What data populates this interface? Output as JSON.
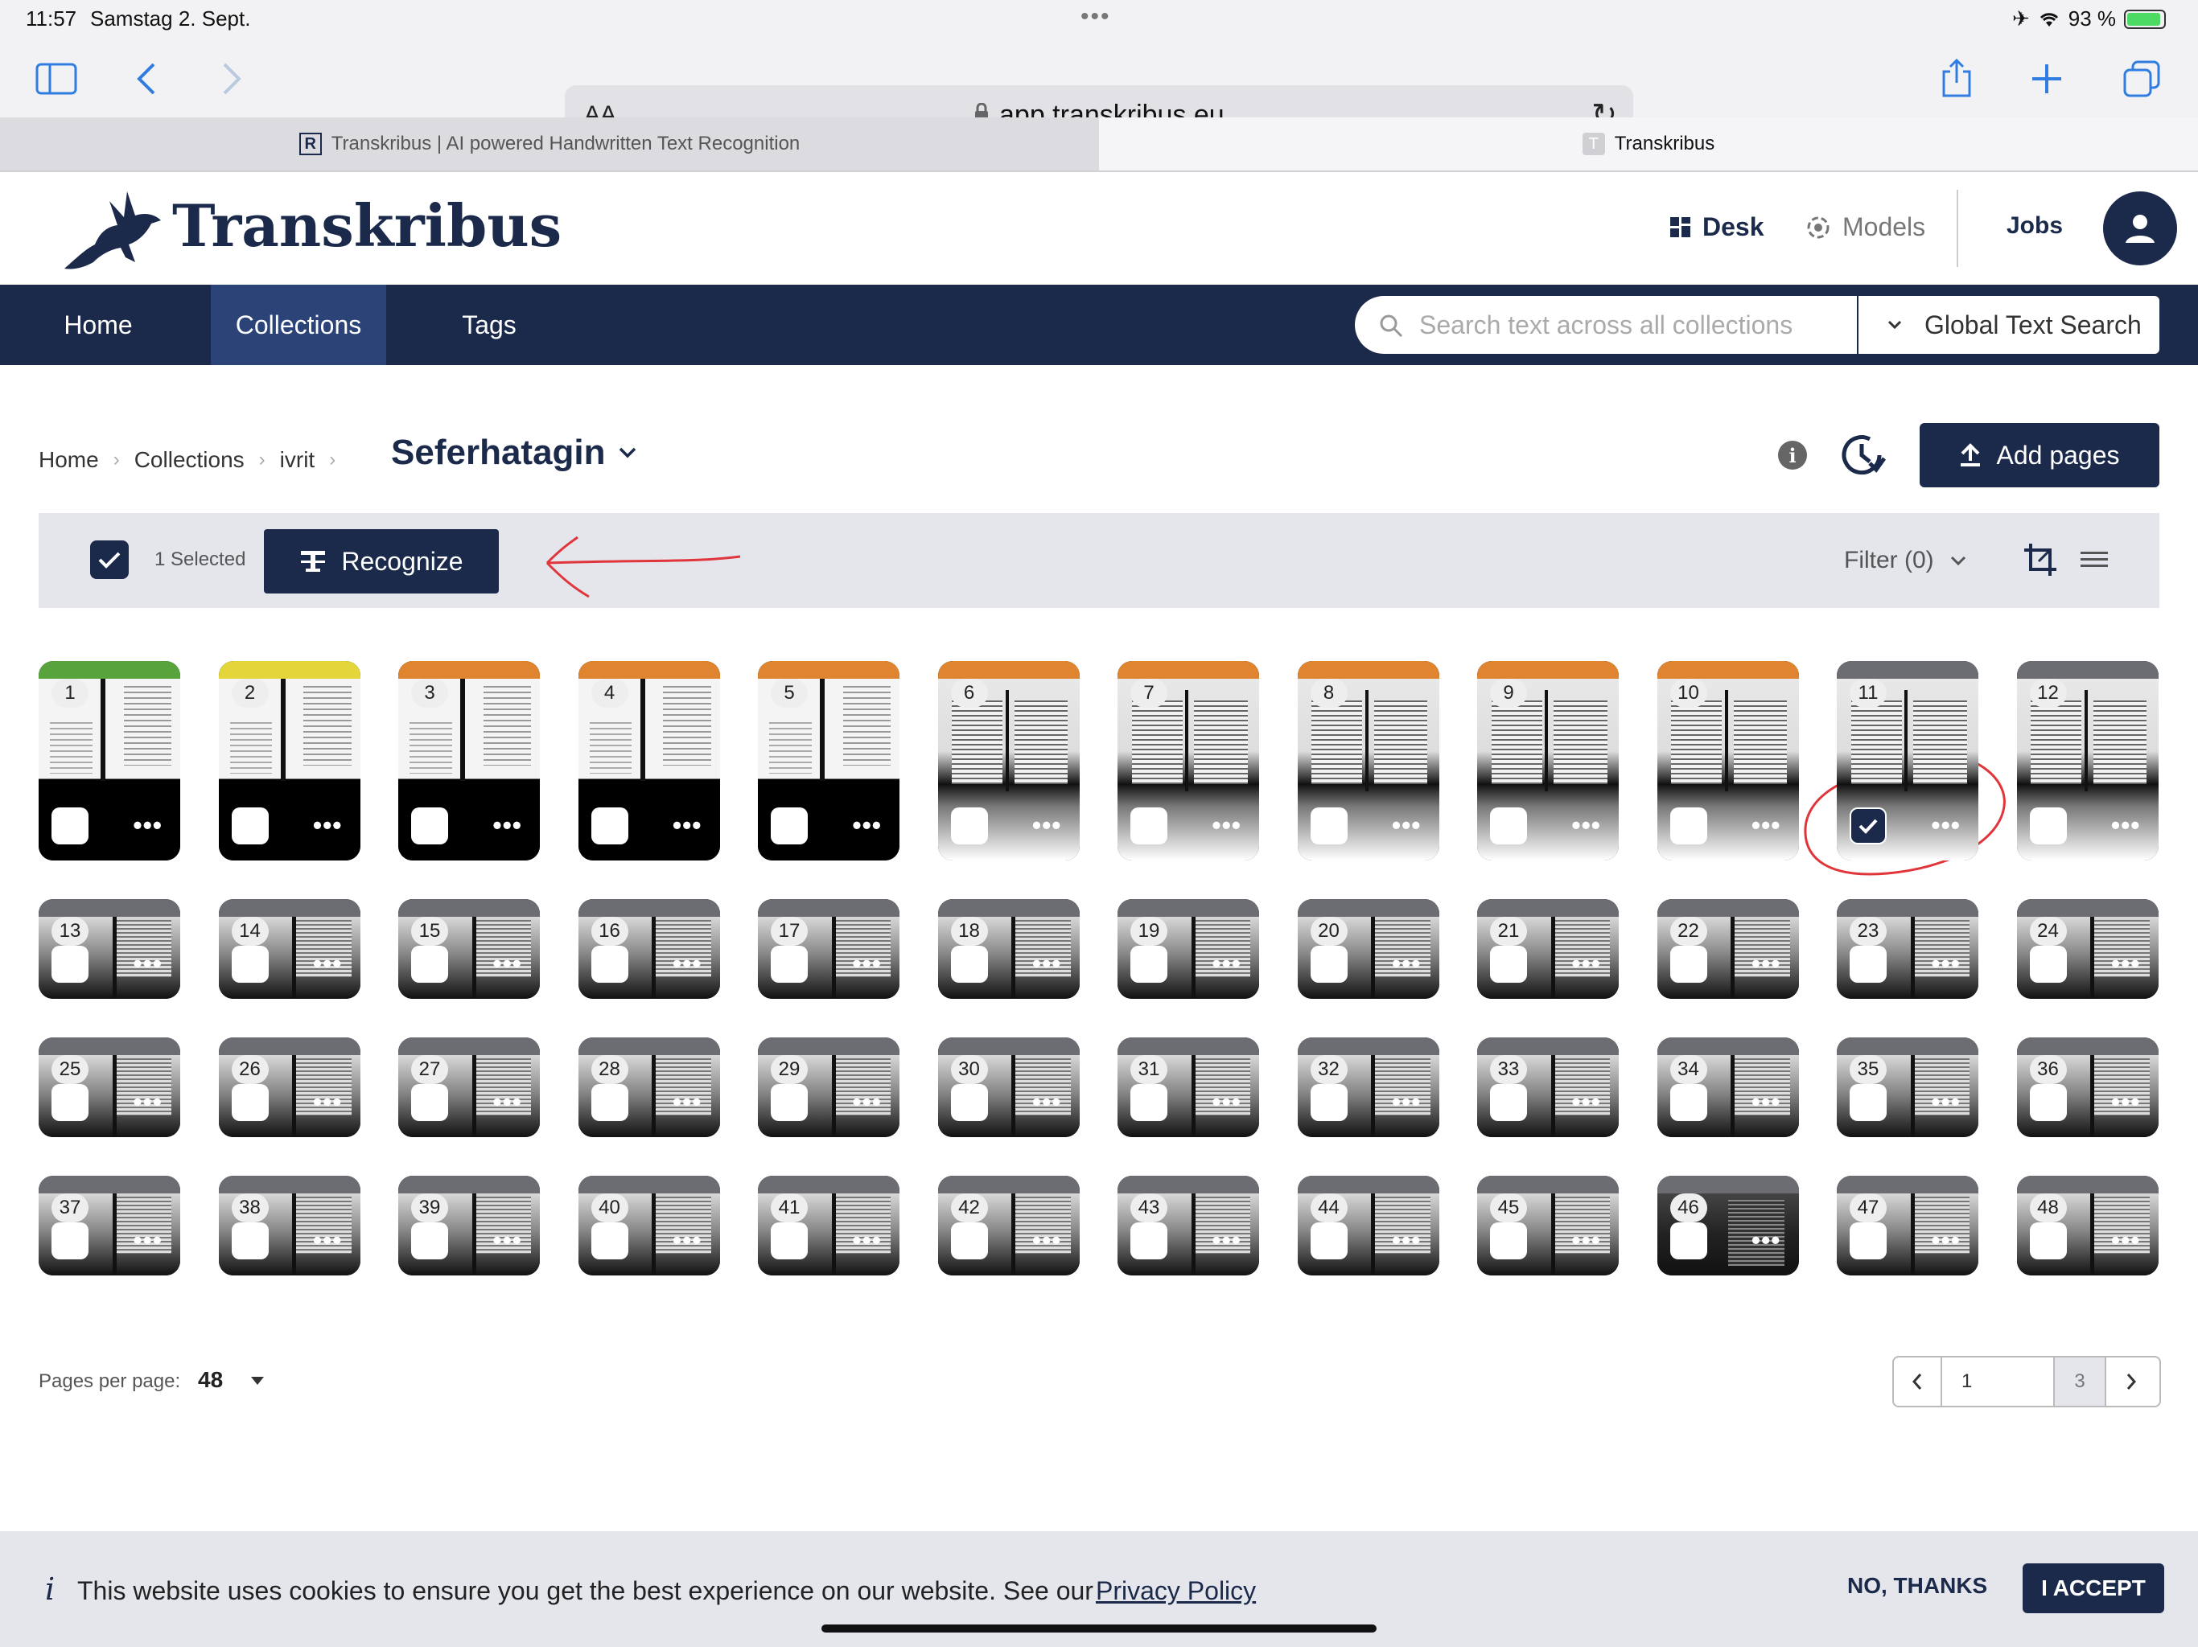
{
  "status": {
    "time": "11:57",
    "date": "Samstag 2. Sept.",
    "battery": "93 %",
    "battery_level": 0.93
  },
  "browser": {
    "aa_label": "AA",
    "url": "app.transkribus.eu",
    "tabs": [
      {
        "label": "Transkribus | AI powered Handwritten Text Recognition",
        "favicon": "R"
      },
      {
        "label": "Transkribus",
        "favicon": "T"
      }
    ]
  },
  "header": {
    "logo": "Transkribus",
    "desk": "Desk",
    "models": "Models",
    "jobs": "Jobs"
  },
  "nav": {
    "items": [
      "Home",
      "Collections",
      "Tags"
    ],
    "active": "Collections",
    "search_placeholder": "Search text across all collections",
    "search_mode": "Global Text Search"
  },
  "breadcrumb": {
    "items": [
      "Home",
      "Collections",
      "ivrit"
    ],
    "current": "Seferhatagin"
  },
  "actions": {
    "add_pages": "Add pages"
  },
  "selection": {
    "count_label": "1 Selected",
    "recognize": "Recognize",
    "filter": "Filter (0)"
  },
  "pages": [
    {
      "n": "1",
      "status": "#58a33c",
      "style": "a",
      "checked": false
    },
    {
      "n": "2",
      "status": "#e4d63a",
      "style": "a",
      "checked": false
    },
    {
      "n": "3",
      "status": "#e0852f",
      "style": "a",
      "checked": false
    },
    {
      "n": "4",
      "status": "#e0852f",
      "style": "a",
      "checked": false
    },
    {
      "n": "5",
      "status": "#e0852f",
      "style": "a",
      "checked": false
    },
    {
      "n": "6",
      "status": "#e0852f",
      "style": "b",
      "checked": false
    },
    {
      "n": "7",
      "status": "#e0852f",
      "style": "b",
      "checked": false
    },
    {
      "n": "8",
      "status": "#e0852f",
      "style": "b",
      "checked": false
    },
    {
      "n": "9",
      "status": "#e0852f",
      "style": "b",
      "checked": false
    },
    {
      "n": "10",
      "status": "#e0852f",
      "style": "b",
      "checked": false
    },
    {
      "n": "11",
      "status": "#6b6d72",
      "style": "b",
      "checked": true
    },
    {
      "n": "12",
      "status": "#6b6d72",
      "style": "b",
      "checked": false
    },
    {
      "n": "13",
      "status": "#6b6d72",
      "style": "c",
      "checked": false
    },
    {
      "n": "14",
      "status": "#6b6d72",
      "style": "c",
      "checked": false
    },
    {
      "n": "15",
      "status": "#6b6d72",
      "style": "c",
      "checked": false
    },
    {
      "n": "16",
      "status": "#6b6d72",
      "style": "c",
      "checked": false
    },
    {
      "n": "17",
      "status": "#6b6d72",
      "style": "c",
      "checked": false
    },
    {
      "n": "18",
      "status": "#6b6d72",
      "style": "c",
      "checked": false
    },
    {
      "n": "19",
      "status": "#6b6d72",
      "style": "c",
      "checked": false
    },
    {
      "n": "20",
      "status": "#6b6d72",
      "style": "c",
      "checked": false
    },
    {
      "n": "21",
      "status": "#6b6d72",
      "style": "c",
      "checked": false
    },
    {
      "n": "22",
      "status": "#6b6d72",
      "style": "c",
      "checked": false
    },
    {
      "n": "23",
      "status": "#6b6d72",
      "style": "c",
      "checked": false
    },
    {
      "n": "24",
      "status": "#6b6d72",
      "style": "c",
      "checked": false
    },
    {
      "n": "25",
      "status": "#6b6d72",
      "style": "c",
      "checked": false
    },
    {
      "n": "26",
      "status": "#6b6d72",
      "style": "c",
      "checked": false
    },
    {
      "n": "27",
      "status": "#6b6d72",
      "style": "c",
      "checked": false
    },
    {
      "n": "28",
      "status": "#6b6d72",
      "style": "c",
      "checked": false
    },
    {
      "n": "29",
      "status": "#6b6d72",
      "style": "c",
      "checked": false
    },
    {
      "n": "30",
      "status": "#6b6d72",
      "style": "c",
      "checked": false
    },
    {
      "n": "31",
      "status": "#6b6d72",
      "style": "c",
      "checked": false
    },
    {
      "n": "32",
      "status": "#6b6d72",
      "style": "c",
      "checked": false
    },
    {
      "n": "33",
      "status": "#6b6d72",
      "style": "c",
      "checked": false
    },
    {
      "n": "34",
      "status": "#6b6d72",
      "style": "c",
      "checked": false
    },
    {
      "n": "35",
      "status": "#6b6d72",
      "style": "c",
      "checked": false
    },
    {
      "n": "36",
      "status": "#6b6d72",
      "style": "c",
      "checked": false
    },
    {
      "n": "37",
      "status": "#6b6d72",
      "style": "c",
      "checked": false
    },
    {
      "n": "38",
      "status": "#6b6d72",
      "style": "c",
      "checked": false
    },
    {
      "n": "39",
      "status": "#6b6d72",
      "style": "c",
      "checked": false
    },
    {
      "n": "40",
      "status": "#6b6d72",
      "style": "c",
      "checked": false
    },
    {
      "n": "41",
      "status": "#6b6d72",
      "style": "c",
      "checked": false
    },
    {
      "n": "42",
      "status": "#6b6d72",
      "style": "c",
      "checked": false
    },
    {
      "n": "43",
      "status": "#6b6d72",
      "style": "c",
      "checked": false
    },
    {
      "n": "44",
      "status": "#6b6d72",
      "style": "c",
      "checked": false
    },
    {
      "n": "45",
      "status": "#6b6d72",
      "style": "c",
      "checked": false
    },
    {
      "n": "46",
      "status": "#6b6d72",
      "style": "d",
      "checked": false
    },
    {
      "n": "47",
      "status": "#6b6d72",
      "style": "c",
      "checked": false
    },
    {
      "n": "48",
      "status": "#6b6d72",
      "style": "c",
      "checked": false
    }
  ],
  "pagination": {
    "per_page_label": "Pages per page:",
    "per_page": "48",
    "current": "1",
    "total": "3"
  },
  "cookie": {
    "text": "This website uses cookies to ensure you get the best experience on our website. See our",
    "link": "Privacy Policy",
    "decline": "NO, THANKS",
    "accept": "I ACCEPT"
  },
  "colors": {
    "brand": "#1b2a4a",
    "nav_active": "#2c4378",
    "annotation": "#e0353a"
  }
}
